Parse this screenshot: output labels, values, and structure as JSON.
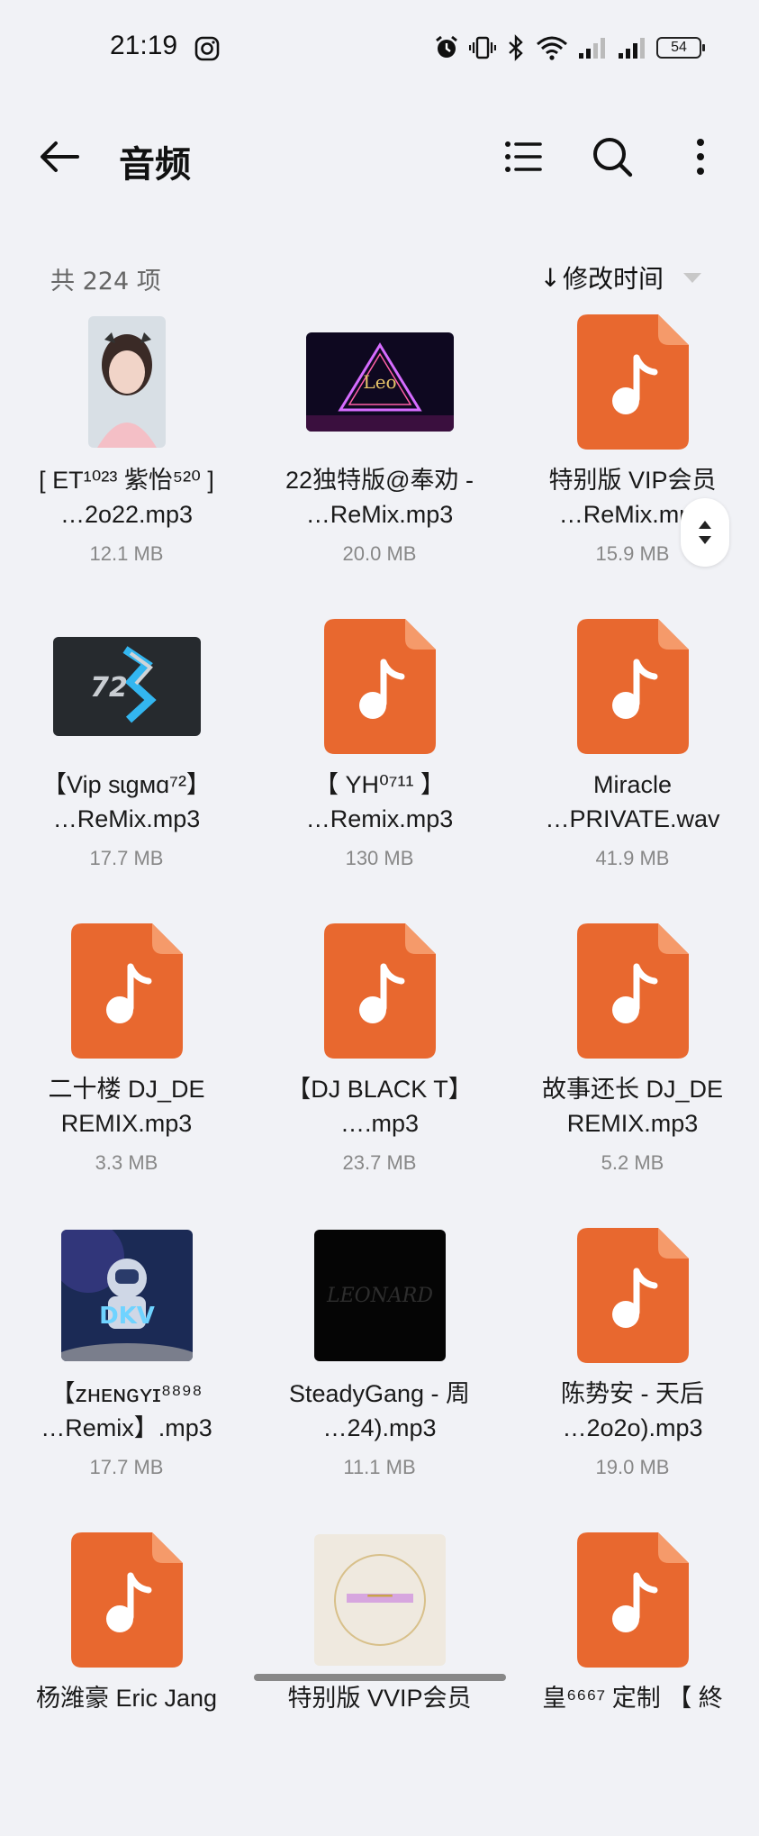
{
  "status": {
    "time": "21:19",
    "battery": "54",
    "icons": [
      "instagram-icon",
      "alarm-icon",
      "vibrate-icon",
      "bluetooth-icon",
      "wifi-icon",
      "signal-icon",
      "signal-icon",
      "battery-icon"
    ]
  },
  "appbar": {
    "title": "音频",
    "icons": [
      "back-arrow-icon",
      "list-view-icon",
      "search-icon",
      "more-vert-icon"
    ]
  },
  "list": {
    "count_label": "共 224 项",
    "sort_label": "修改时间",
    "sort_arrow": "↓"
  },
  "accent_color": "#e8682f",
  "files": [
    {
      "name_line1": "[ ET¹⁰²³ 紫怡⁵²⁰ ]",
      "name_line2": "…2o22.mp3",
      "size": "12.1 MB",
      "thumb": "photo-portrait"
    },
    {
      "name_line1": "22独特版@奉劝 -",
      "name_line2": "…ReMix.mp3",
      "size": "20.0 MB",
      "thumb": "photo-neon-triangle"
    },
    {
      "name_line1": "特别版 VIP会员",
      "name_line2": "…ReMix.mp3",
      "size": "15.9 MB",
      "thumb": "audio-file-icon"
    },
    {
      "name_line1": "【Vip sɩgмɑ⁷²】",
      "name_line2": "…ReMix.mp3",
      "size": "17.7 MB",
      "thumb": "photo-72-logo"
    },
    {
      "name_line1": "【 YH⁰⁷¹¹ 】",
      "name_line2": "…Remix.mp3",
      "size": "130 MB",
      "thumb": "audio-file-icon"
    },
    {
      "name_line1": "Miracle",
      "name_line2": "…PRIVATE.wav",
      "size": "41.9 MB",
      "thumb": "audio-file-icon"
    },
    {
      "name_line1": "二十楼 DJ_DE",
      "name_line2": "REMIX.mp3",
      "size": "3.3 MB",
      "thumb": "audio-file-icon"
    },
    {
      "name_line1": "【DJ BLACK T】",
      "name_line2": "….mp3",
      "size": "23.7 MB",
      "thumb": "audio-file-icon"
    },
    {
      "name_line1": "故事还长 DJ_DE",
      "name_line2": "REMIX.mp3",
      "size": "5.2 MB",
      "thumb": "audio-file-icon"
    },
    {
      "name_line1": "【ᴢʜᴇɴɢʏɪ⁸⁸⁹⁸",
      "name_line2": "…Remix】.mp3",
      "size": "17.7 MB",
      "thumb": "photo-dkv-astronaut"
    },
    {
      "name_line1": "SteadyGang - 周",
      "name_line2": "…24).mp3",
      "size": "11.1 MB",
      "thumb": "photo-leonard-dark"
    },
    {
      "name_line1": "陈势安 - 天后",
      "name_line2": "…2o2o).mp3",
      "size": "19.0 MB",
      "thumb": "audio-file-icon"
    },
    {
      "name_line1": "杨潍豪 Eric Jang",
      "name_line2": "",
      "size": "",
      "thumb": "audio-file-icon"
    },
    {
      "name_line1": "特别版 VVIP会员",
      "name_line2": "",
      "size": "",
      "thumb": "photo-gold-frame"
    },
    {
      "name_line1": "皇⁶⁶⁶⁷ 定制 【 終",
      "name_line2": "",
      "size": "",
      "thumb": "audio-file-icon"
    }
  ]
}
